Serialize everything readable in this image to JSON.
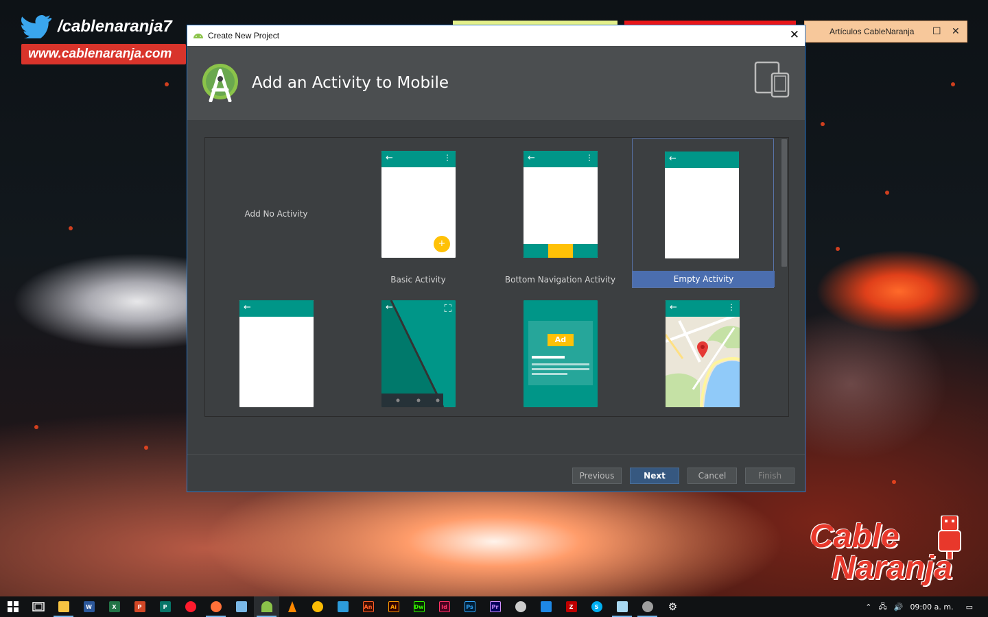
{
  "branding": {
    "handle": "/cablenaranja7",
    "url": "www.cablenaranja.com",
    "logo_line1": "Cable",
    "logo_line2": "Naranja"
  },
  "background_window": {
    "title": "Artículos CableNaranja"
  },
  "dialog": {
    "window_title": "Create New Project",
    "heading": "Add an Activity to Mobile",
    "activities": [
      {
        "label": "Add No Activity",
        "selected": false
      },
      {
        "label": "Basic Activity",
        "selected": false
      },
      {
        "label": "Bottom Navigation Activity",
        "selected": false
      },
      {
        "label": "Empty Activity",
        "selected": true
      },
      {
        "label": "",
        "selected": false
      },
      {
        "label": "",
        "selected": false
      },
      {
        "label": "",
        "selected": false
      },
      {
        "label": "",
        "selected": false
      }
    ],
    "ad_label": "Ad",
    "buttons": {
      "previous": "Previous",
      "next": "Next",
      "cancel": "Cancel",
      "finish": "Finish"
    }
  },
  "taskbar": {
    "apps": [
      "windows-start",
      "task-view",
      "file-explorer",
      "word",
      "excel",
      "powerpoint",
      "publisher",
      "opera",
      "firefox",
      "virtualbox",
      "android-studio",
      "vlc",
      "drive",
      "layers",
      "animate",
      "illustrator",
      "dreamweaver",
      "indesign",
      "photoshop",
      "premiere",
      "github",
      "dev-tool",
      "filezilla",
      "skype",
      "notepad",
      "mobile-tool",
      "settings"
    ],
    "clock": "09:00 a. m."
  },
  "colors": {
    "accent": "#009688",
    "selection": "#4b6eaf",
    "fab": "#ffc107",
    "brand_red": "#d9342b"
  }
}
